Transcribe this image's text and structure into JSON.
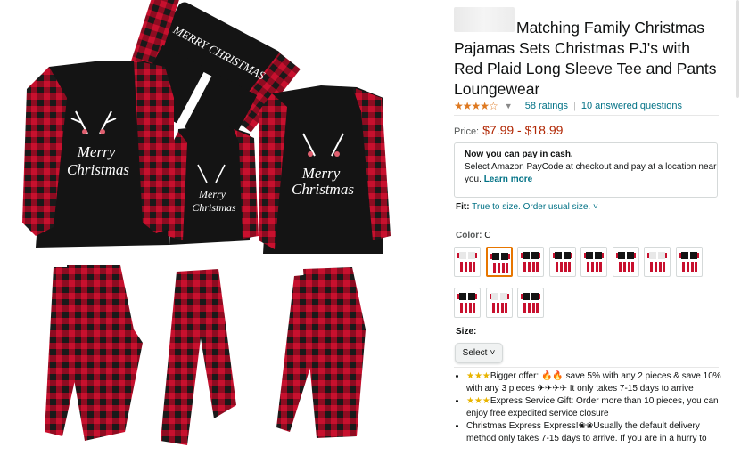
{
  "product": {
    "title": "Matching Family Christmas Pajamas Sets Christmas PJ's with Red Plaid Long Sleeve Tee and Pants Loungewear",
    "shirt_print": "MERRY CHRISTMAS",
    "rating": {
      "stars": 4.5,
      "star_glyphs": "★★★★☆",
      "ratings_text": "58 ratings",
      "separator": "|",
      "answered_text": "10 answered questions"
    },
    "price": {
      "label": "Price:",
      "range": "$7.99 - $18.99"
    },
    "paycode": {
      "heading": "Now you can pay in cash.",
      "body": "Select Amazon PayCode at checkout and pay at a location near you.",
      "link": "Learn more"
    },
    "fit": {
      "label": "Fit:",
      "value": "True to size. Order usual size.",
      "chevron": "˅"
    },
    "color": {
      "label": "Color:",
      "value": "C",
      "swatch_count": 11,
      "selected_index": 1
    },
    "size": {
      "label": "Size:",
      "select_label": "Select",
      "chevron": "˅"
    },
    "bullets": [
      {
        "stars": "★★★",
        "text": "Bigger offer: 🔥🔥 save 5% with any 2 pieces & save 10% with any 3 pieces ✈✈✈✈ It only takes 7-15 days to arrive"
      },
      {
        "stars": "★★★",
        "text": "Express Service Gift: Order more than 10 pieces, you can enjoy free expedited service closure"
      },
      {
        "stars": "",
        "text": "Christmas Express Express!❀❀Usually the default delivery method only takes 7-15 days to arrive. If you are in a hurry to"
      }
    ]
  },
  "colors": {
    "plaid_red": "#c8102e",
    "plaid_dark": "#1a1a1a",
    "shirt_black": "#141414",
    "link": "#007185",
    "price": "#b12704",
    "star": "#de7921",
    "selected_border": "#e77600"
  }
}
